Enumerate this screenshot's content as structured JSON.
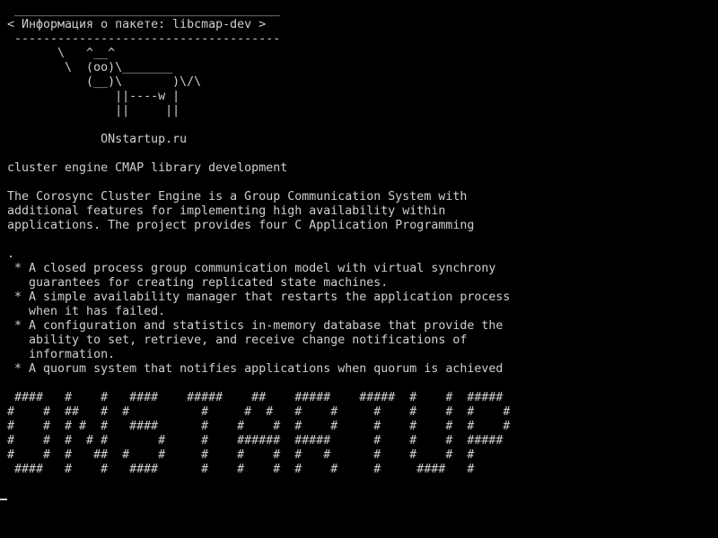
{
  "terminal": {
    "background_color": "#000000",
    "text_color": "#cfcfcf",
    "lines": [
      " _____________________________________",
      "< Информация о пакете: libcmap-dev >",
      " -------------------------------------",
      "       \\   ^__^",
      "        \\  (oo)\\_______",
      "           (__)\\       )\\/\\",
      "               ||----w |",
      "               ||     ||",
      "",
      "             ONstartup.ru",
      "",
      "cluster engine CMAP library development",
      "",
      "The Corosync Cluster Engine is a Group Communication System with",
      "additional features for implementing high availability within",
      "applications. The project provides four C Application Programming",
      "",
      ".",
      " * A closed process group communication model with virtual synchrony",
      "   guarantees for creating replicated state machines.",
      " * A simple availability manager that restarts the application process",
      "   when it has failed.",
      " * A configuration and statistics in-memory database that provide the",
      "   ability to set, retrieve, and receive change notifications of",
      "   information.",
      " * A quorum system that notifies applications when quorum is achieved",
      "",
      " ####   #    #   ####    #####    ##    #####    #####  #    #  #####",
      "#    #  ##   #  #          #     #  #   #    #     #    #    #  #    #",
      "#    #  # #  #   ####      #    #    #  #    #     #    #    #  #    #",
      "#    #  #  # #       #     #    ######  #####      #    #    #  #####",
      "#    #  #   ##  #    #     #    #    #  #   #      #    #    #  #",
      " ####   #    #   ####      #    #    #  #    #     #     ####   #"
    ]
  }
}
